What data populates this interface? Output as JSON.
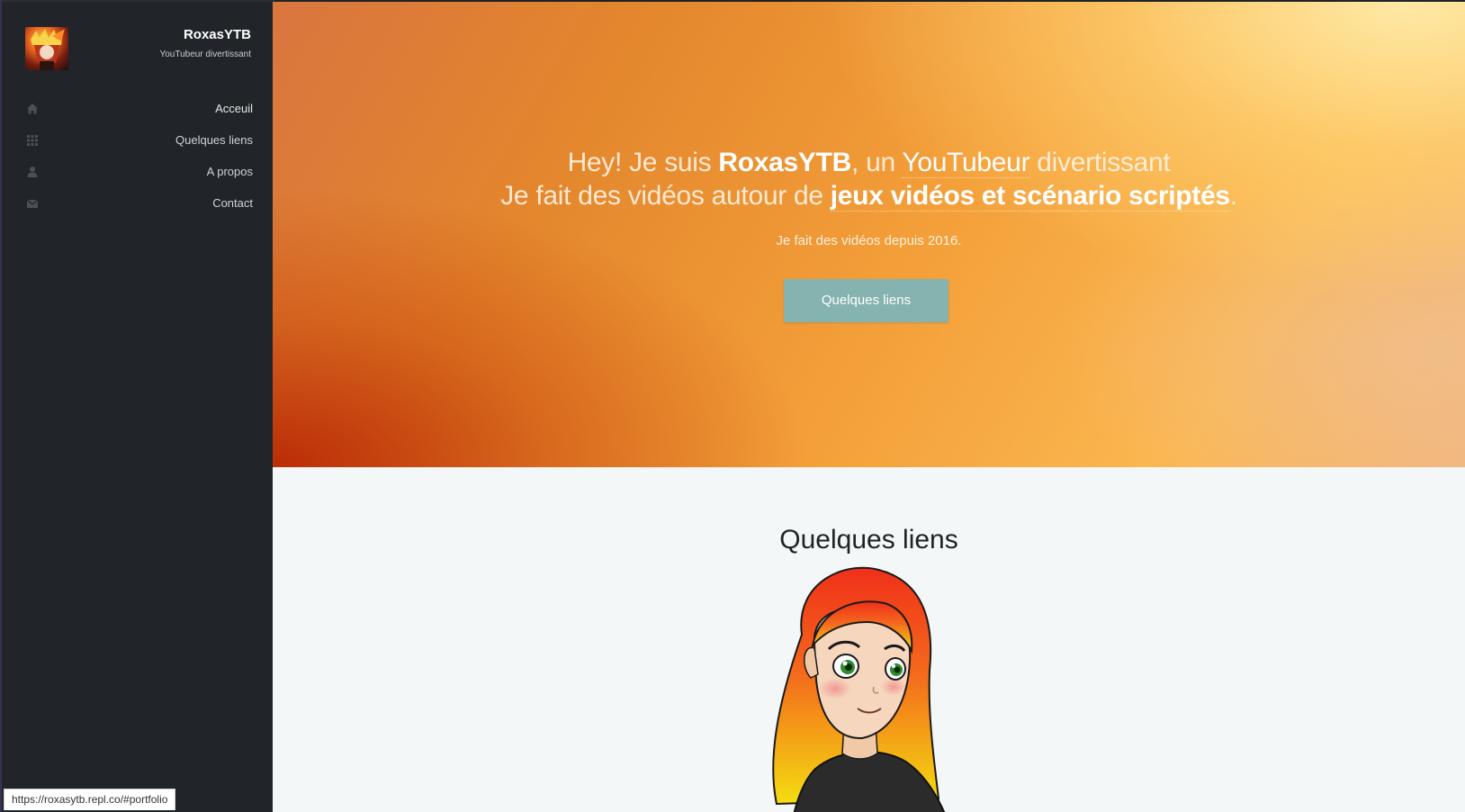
{
  "sidebar": {
    "brand_name": "RoxasYTB",
    "brand_tagline": "YouTubeur divertissant",
    "avatar_icon": "avatar-image",
    "items": [
      {
        "label": "Acceuil",
        "icon": "home-icon"
      },
      {
        "label": "Quelques liens",
        "icon": "grid-icon"
      },
      {
        "label": "A propos",
        "icon": "user-icon"
      },
      {
        "label": "Contact",
        "icon": "envelope-icon"
      }
    ]
  },
  "hero": {
    "line1": {
      "part1": "Hey! Je suis ",
      "name": "RoxasYTB",
      "part2": ", un ",
      "link": "YouTubeur",
      "part3": " divertissant"
    },
    "line2": {
      "part1": "Je fait des vidéos autour de ",
      "link": "jeux vidéos et scénario scriptés",
      "part2": "."
    },
    "subtitle": "Je fait des vidéos depuis 2016.",
    "button_label": "Quelques liens",
    "accent_color": "#84b3b0"
  },
  "section": {
    "title": "Quelques liens",
    "image_icon": "character-illustration"
  },
  "statusbar": {
    "url": "https://roxasytb.repl.co/#portfolio"
  }
}
